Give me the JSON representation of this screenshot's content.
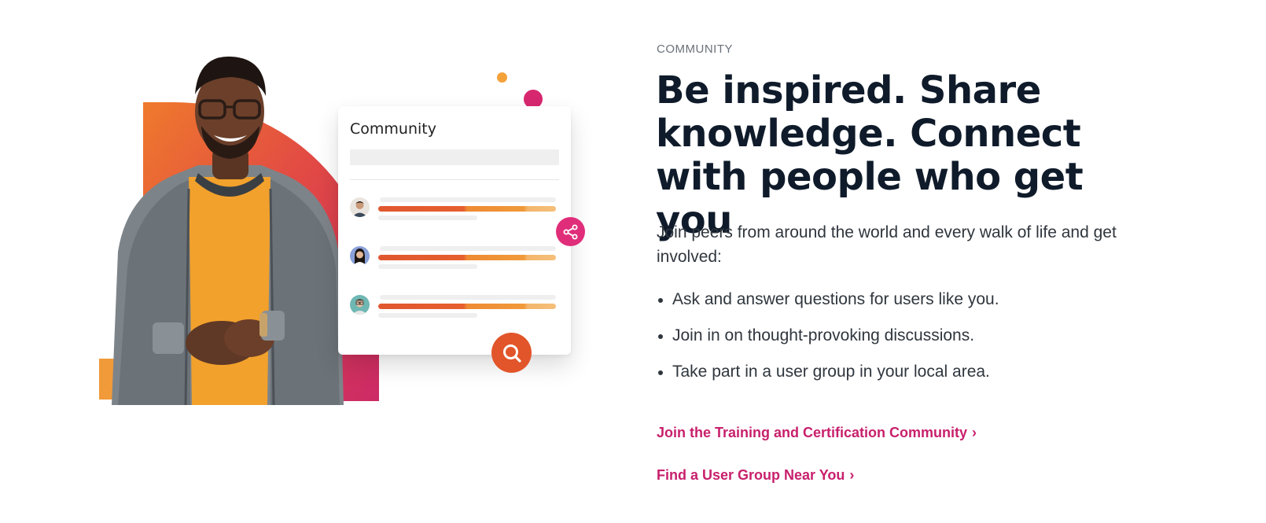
{
  "illustration": {
    "card": {
      "title": "Community",
      "rows": [
        {
          "avatar": "avatar-man"
        },
        {
          "avatar": "avatar-woman"
        },
        {
          "avatar": "avatar-man-glasses"
        }
      ]
    },
    "icons": {
      "share": "share-icon",
      "search": "search-icon"
    },
    "colors": {
      "orange": "#f09a3a",
      "red": "#e2552a",
      "pink": "#d7286f"
    }
  },
  "content": {
    "eyebrow": "COMMUNITY",
    "headline": "Be inspired. Share knowledge. Connect with people who get you",
    "intro": "Join peers from around the world and every walk of life and get involved:",
    "bullets": [
      "Ask and answer questions for users like you.",
      "Join in on thought-provoking discussions.",
      "Take part in a user group in your local area."
    ],
    "links": [
      {
        "label": "Join the Training and Certification Community",
        "chevron": "›"
      },
      {
        "label": "Find a User Group Near You",
        "chevron": "›"
      }
    ],
    "link_color": "#c8206c"
  }
}
